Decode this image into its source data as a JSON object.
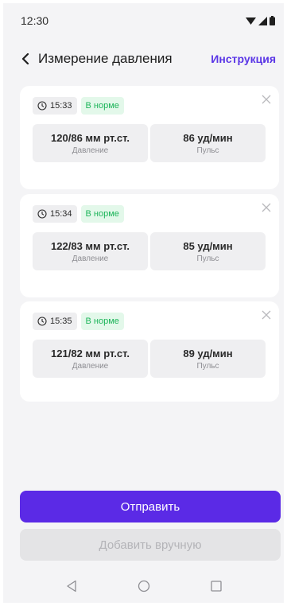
{
  "status_bar": {
    "time": "12:30"
  },
  "header": {
    "title": "Измерение давления",
    "instructions_link": "Инструкция"
  },
  "measurements": [
    {
      "time": "15:33",
      "status": "В норме",
      "pressure": "120/86 мм рт.ст.",
      "pressure_label": "Давление",
      "pulse": "86 уд/мин",
      "pulse_label": "Пульс"
    },
    {
      "time": "15:34",
      "status": "В норме",
      "pressure": "122/83 мм рт.ст.",
      "pressure_label": "Давление",
      "pulse": "85 уд/мин",
      "pulse_label": "Пульс"
    },
    {
      "time": "15:35",
      "status": "В норме",
      "pressure": "121/82 мм рт.ст.",
      "pressure_label": "Давление",
      "pulse": "89 уд/мин",
      "pulse_label": "Пульс"
    }
  ],
  "actions": {
    "send_label": "Отправить",
    "add_manual_label": "Добавить вручную"
  },
  "colors": {
    "accent": "#5b2ae6",
    "status_ok": "#1db55a"
  }
}
